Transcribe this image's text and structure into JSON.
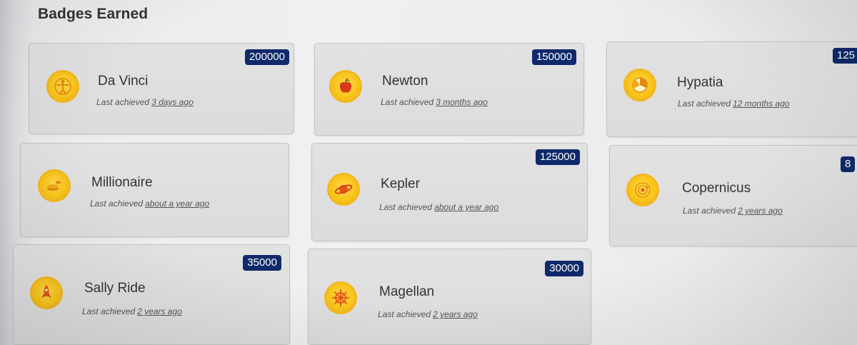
{
  "section_title": "Badges Earned",
  "last_achieved_prefix": "Last achieved",
  "badges": [
    {
      "name": "Da Vinci",
      "ago": "3 days ago",
      "points": "200000",
      "icon": "vitruvian-man-icon"
    },
    {
      "name": "Newton",
      "ago": "3 months ago",
      "points": "150000",
      "icon": "apple-icon"
    },
    {
      "name": "Hypatia",
      "ago": "12 months ago",
      "points": "125",
      "icon": "geometry-icon"
    },
    {
      "name": "Millionaire",
      "ago": "about a year ago",
      "points": "",
      "icon": "money-icon"
    },
    {
      "name": "Kepler",
      "ago": "about a year ago",
      "points": "125000",
      "icon": "planet-icon"
    },
    {
      "name": "Copernicus",
      "ago": "2 years ago",
      "points": "8",
      "icon": "orbit-icon"
    },
    {
      "name": "Sally Ride",
      "ago": "2 years ago",
      "points": "35000",
      "icon": "rocket-icon"
    },
    {
      "name": "Magellan",
      "ago": "2 years ago",
      "points": "30000",
      "icon": "ship-wheel-icon"
    }
  ]
}
